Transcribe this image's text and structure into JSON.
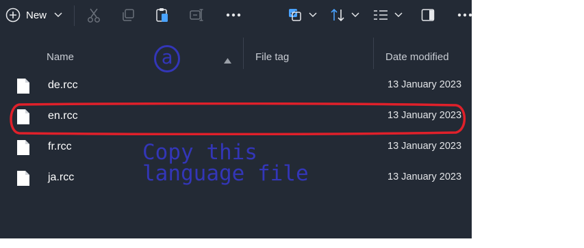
{
  "toolbar": {
    "new_label": "New",
    "icons": [
      "add-icon",
      "chevron-down-icon",
      "cut-icon",
      "copy-icon",
      "paste-icon",
      "rename-icon",
      "more-icon",
      "select-icon",
      "sort-icon",
      "view-icon",
      "details-pane-icon"
    ]
  },
  "columns": {
    "name": "Name",
    "file_tag": "File tag",
    "date_modified": "Date modified"
  },
  "files": [
    {
      "name": "de.rcc",
      "date": "13 January 2023"
    },
    {
      "name": "en.rcc",
      "date": "13 January 2023"
    },
    {
      "name": "fr.rcc",
      "date": "13 January 2023"
    },
    {
      "name": "ja.rcc",
      "date": "13 January 2023"
    }
  ],
  "annotations": {
    "marker": "a",
    "note": "Copy this\nlanguage file",
    "color": "#3336b8",
    "highlight_color": "#e0202a"
  },
  "colors": {
    "background": "#232a35",
    "accent": "#4aa3ff"
  }
}
